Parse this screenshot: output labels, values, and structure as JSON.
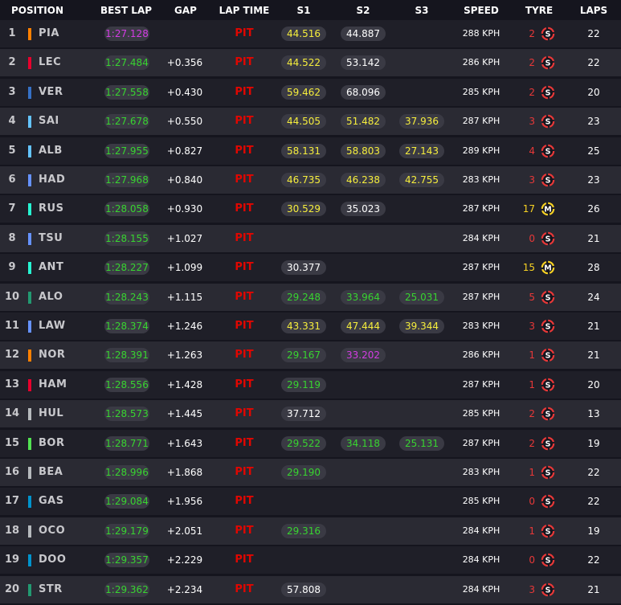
{
  "headers": {
    "position": "POSITION",
    "best_lap": "BEST LAP",
    "gap": "GAP",
    "lap_time": "LAP TIME",
    "s1": "S1",
    "s2": "S2",
    "s3": "S3",
    "speed": "SPEED",
    "tyre": "TYRE",
    "laps": "LAPS"
  },
  "colors": {
    "purple": "#d43ce4",
    "green": "#38d430",
    "yellow": "#f6ee3c",
    "white": "#ffffff",
    "pit_red": "#e10600",
    "soft_tyre": "#e83838",
    "medium_tyre": "#f7d224"
  },
  "rows": [
    {
      "pos": "1",
      "team_color": "#ff8000",
      "driver": "PIA",
      "best_lap": "1:27.128",
      "best_lap_color": "purple",
      "gap": "",
      "lap_time": "PIT",
      "s1": "44.516",
      "s1_color": "yellow",
      "s2": "44.887",
      "s2_color": "white",
      "s3": "",
      "s3_color": "",
      "speed": "288 KPH",
      "tyre_age": "2",
      "tyre": "S",
      "tyre_icon": "soft-tyre-icon",
      "laps": "22"
    },
    {
      "pos": "2",
      "team_color": "#e8002d",
      "driver": "LEC",
      "best_lap": "1:27.484",
      "best_lap_color": "green",
      "gap": "+0.356",
      "lap_time": "PIT",
      "s1": "44.522",
      "s1_color": "yellow",
      "s2": "53.142",
      "s2_color": "white",
      "s3": "",
      "s3_color": "",
      "speed": "286 KPH",
      "tyre_age": "2",
      "tyre": "S",
      "tyre_icon": "soft-tyre-icon",
      "laps": "22"
    },
    {
      "pos": "3",
      "team_color": "#3671c6",
      "driver": "VER",
      "best_lap": "1:27.558",
      "best_lap_color": "green",
      "gap": "+0.430",
      "lap_time": "PIT",
      "s1": "59.462",
      "s1_color": "yellow",
      "s2": "68.096",
      "s2_color": "white",
      "s3": "",
      "s3_color": "",
      "speed": "285 KPH",
      "tyre_age": "2",
      "tyre": "S",
      "tyre_icon": "soft-tyre-icon",
      "laps": "20"
    },
    {
      "pos": "4",
      "team_color": "#64c4ff",
      "driver": "SAI",
      "best_lap": "1:27.678",
      "best_lap_color": "green",
      "gap": "+0.550",
      "lap_time": "PIT",
      "s1": "44.505",
      "s1_color": "yellow",
      "s2": "51.482",
      "s2_color": "yellow",
      "s3": "37.936",
      "s3_color": "yellow",
      "speed": "287 KPH",
      "tyre_age": "3",
      "tyre": "S",
      "tyre_icon": "soft-tyre-icon",
      "laps": "23"
    },
    {
      "pos": "5",
      "team_color": "#64c4ff",
      "driver": "ALB",
      "best_lap": "1:27.955",
      "best_lap_color": "green",
      "gap": "+0.827",
      "lap_time": "PIT",
      "s1": "58.131",
      "s1_color": "yellow",
      "s2": "58.803",
      "s2_color": "yellow",
      "s3": "27.143",
      "s3_color": "yellow",
      "speed": "289 KPH",
      "tyre_age": "4",
      "tyre": "S",
      "tyre_icon": "soft-tyre-icon",
      "laps": "25"
    },
    {
      "pos": "6",
      "team_color": "#6692ff",
      "driver": "HAD",
      "best_lap": "1:27.968",
      "best_lap_color": "green",
      "gap": "+0.840",
      "lap_time": "PIT",
      "s1": "46.735",
      "s1_color": "yellow",
      "s2": "46.238",
      "s2_color": "yellow",
      "s3": "42.755",
      "s3_color": "yellow",
      "speed": "283 KPH",
      "tyre_age": "3",
      "tyre": "S",
      "tyre_icon": "soft-tyre-icon",
      "laps": "23"
    },
    {
      "pos": "7",
      "team_color": "#27f4d2",
      "driver": "RUS",
      "best_lap": "1:28.058",
      "best_lap_color": "green",
      "gap": "+0.930",
      "lap_time": "PIT",
      "s1": "30.529",
      "s1_color": "yellow",
      "s2": "35.023",
      "s2_color": "white",
      "s3": "",
      "s3_color": "",
      "speed": "287 KPH",
      "tyre_age": "17",
      "tyre": "M",
      "tyre_icon": "medium-tyre-icon",
      "laps": "26"
    },
    {
      "pos": "8",
      "team_color": "#6692ff",
      "driver": "TSU",
      "best_lap": "1:28.155",
      "best_lap_color": "green",
      "gap": "+1.027",
      "lap_time": "PIT",
      "s1": "",
      "s1_color": "",
      "s2": "",
      "s2_color": "",
      "s3": "",
      "s3_color": "",
      "speed": "284 KPH",
      "tyre_age": "0",
      "tyre": "S",
      "tyre_icon": "soft-tyre-icon",
      "laps": "21"
    },
    {
      "pos": "9",
      "team_color": "#27f4d2",
      "driver": "ANT",
      "best_lap": "1:28.227",
      "best_lap_color": "green",
      "gap": "+1.099",
      "lap_time": "PIT",
      "s1": "30.377",
      "s1_color": "white",
      "s2": "",
      "s2_color": "",
      "s3": "",
      "s3_color": "",
      "speed": "287 KPH",
      "tyre_age": "15",
      "tyre": "M",
      "tyre_icon": "medium-tyre-icon",
      "laps": "28"
    },
    {
      "pos": "10",
      "team_color": "#229971",
      "driver": "ALO",
      "best_lap": "1:28.243",
      "best_lap_color": "green",
      "gap": "+1.115",
      "lap_time": "PIT",
      "s1": "29.248",
      "s1_color": "green",
      "s2": "33.964",
      "s2_color": "green",
      "s3": "25.031",
      "s3_color": "green",
      "speed": "287 KPH",
      "tyre_age": "5",
      "tyre": "S",
      "tyre_icon": "soft-tyre-icon",
      "laps": "24"
    },
    {
      "pos": "11",
      "team_color": "#6692ff",
      "driver": "LAW",
      "best_lap": "1:28.374",
      "best_lap_color": "green",
      "gap": "+1.246",
      "lap_time": "PIT",
      "s1": "43.331",
      "s1_color": "yellow",
      "s2": "47.444",
      "s2_color": "yellow",
      "s3": "39.344",
      "s3_color": "yellow",
      "speed": "283 KPH",
      "tyre_age": "3",
      "tyre": "S",
      "tyre_icon": "soft-tyre-icon",
      "laps": "21"
    },
    {
      "pos": "12",
      "team_color": "#ff8000",
      "driver": "NOR",
      "best_lap": "1:28.391",
      "best_lap_color": "green",
      "gap": "+1.263",
      "lap_time": "PIT",
      "s1": "29.167",
      "s1_color": "green",
      "s2": "33.202",
      "s2_color": "purple",
      "s3": "",
      "s3_color": "",
      "speed": "286 KPH",
      "tyre_age": "1",
      "tyre": "S",
      "tyre_icon": "soft-tyre-icon",
      "laps": "21"
    },
    {
      "pos": "13",
      "team_color": "#e8002d",
      "driver": "HAM",
      "best_lap": "1:28.556",
      "best_lap_color": "green",
      "gap": "+1.428",
      "lap_time": "PIT",
      "s1": "29.119",
      "s1_color": "green",
      "s2": "",
      "s2_color": "",
      "s3": "",
      "s3_color": "",
      "speed": "287 KPH",
      "tyre_age": "1",
      "tyre": "S",
      "tyre_icon": "soft-tyre-icon",
      "laps": "20"
    },
    {
      "pos": "14",
      "team_color": "#b6babd",
      "driver": "HUL",
      "best_lap": "1:28.573",
      "best_lap_color": "green",
      "gap": "+1.445",
      "lap_time": "PIT",
      "s1": "37.712",
      "s1_color": "white",
      "s2": "",
      "s2_color": "",
      "s3": "",
      "s3_color": "",
      "speed": "285 KPH",
      "tyre_age": "2",
      "tyre": "S",
      "tyre_icon": "soft-tyre-icon",
      "laps": "13"
    },
    {
      "pos": "15",
      "team_color": "#52e252",
      "driver": "BOR",
      "best_lap": "1:28.771",
      "best_lap_color": "green",
      "gap": "+1.643",
      "lap_time": "PIT",
      "s1": "29.522",
      "s1_color": "green",
      "s2": "34.118",
      "s2_color": "green",
      "s3": "25.131",
      "s3_color": "green",
      "speed": "287 KPH",
      "tyre_age": "2",
      "tyre": "S",
      "tyre_icon": "soft-tyre-icon",
      "laps": "19"
    },
    {
      "pos": "16",
      "team_color": "#b6babd",
      "driver": "BEA",
      "best_lap": "1:28.996",
      "best_lap_color": "green",
      "gap": "+1.868",
      "lap_time": "PIT",
      "s1": "29.190",
      "s1_color": "green",
      "s2": "",
      "s2_color": "",
      "s3": "",
      "s3_color": "",
      "speed": "283 KPH",
      "tyre_age": "1",
      "tyre": "S",
      "tyre_icon": "soft-tyre-icon",
      "laps": "22"
    },
    {
      "pos": "17",
      "team_color": "#0093cc",
      "driver": "GAS",
      "best_lap": "1:29.084",
      "best_lap_color": "green",
      "gap": "+1.956",
      "lap_time": "PIT",
      "s1": "",
      "s1_color": "",
      "s2": "",
      "s2_color": "",
      "s3": "",
      "s3_color": "",
      "speed": "285 KPH",
      "tyre_age": "0",
      "tyre": "S",
      "tyre_icon": "soft-tyre-icon",
      "laps": "22"
    },
    {
      "pos": "18",
      "team_color": "#b6babd",
      "driver": "OCO",
      "best_lap": "1:29.179",
      "best_lap_color": "green",
      "gap": "+2.051",
      "lap_time": "PIT",
      "s1": "29.316",
      "s1_color": "green",
      "s2": "",
      "s2_color": "",
      "s3": "",
      "s3_color": "",
      "speed": "284 KPH",
      "tyre_age": "1",
      "tyre": "S",
      "tyre_icon": "soft-tyre-icon",
      "laps": "19"
    },
    {
      "pos": "19",
      "team_color": "#0093cc",
      "driver": "DOO",
      "best_lap": "1:29.357",
      "best_lap_color": "green",
      "gap": "+2.229",
      "lap_time": "PIT",
      "s1": "",
      "s1_color": "",
      "s2": "",
      "s2_color": "",
      "s3": "",
      "s3_color": "",
      "speed": "284 KPH",
      "tyre_age": "0",
      "tyre": "S",
      "tyre_icon": "soft-tyre-icon",
      "laps": "22"
    },
    {
      "pos": "20",
      "team_color": "#229971",
      "driver": "STR",
      "best_lap": "1:29.362",
      "best_lap_color": "green",
      "gap": "+2.234",
      "lap_time": "PIT",
      "s1": "57.808",
      "s1_color": "white",
      "s2": "",
      "s2_color": "",
      "s3": "",
      "s3_color": "",
      "speed": "284 KPH",
      "tyre_age": "3",
      "tyre": "S",
      "tyre_icon": "soft-tyre-icon",
      "laps": "21"
    }
  ]
}
